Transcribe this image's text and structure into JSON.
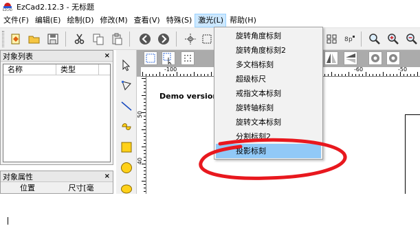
{
  "window": {
    "title": "EzCad2.12.3 - 无标题",
    "logo_text": "EZCAD"
  },
  "menubar": {
    "items": [
      {
        "label": "文件(F)"
      },
      {
        "label": "编辑(E)"
      },
      {
        "label": "绘制(D)"
      },
      {
        "label": "修改(M)"
      },
      {
        "label": "查看(V)"
      },
      {
        "label": "特殊(S)"
      },
      {
        "label": "激光(L)"
      },
      {
        "label": "帮助(H)"
      }
    ]
  },
  "laser_menu": {
    "items": [
      {
        "label": "旋转角度标刻"
      },
      {
        "label": "旋转角度标刻2"
      },
      {
        "label": "多文档标刻"
      },
      {
        "label": "超级标尺"
      },
      {
        "label": "戒指文本标刻"
      },
      {
        "label": "旋转轴标刻"
      },
      {
        "label": "旋转文本标刻"
      },
      {
        "label": "分割标刻2"
      },
      {
        "label": "投影标刻"
      }
    ],
    "highlighted": "投影标刻"
  },
  "object_list_panel": {
    "title": "对象列表",
    "close": "×",
    "columns": [
      "名称",
      "类型"
    ]
  },
  "object_props_panel": {
    "title": "对象属性",
    "close": "×",
    "columns": [
      "位置",
      "尺寸[毫"
    ]
  },
  "canvas": {
    "demo_text": "Demo version",
    "h_ruler_labels": [
      "-100",
      "-60",
      "-50"
    ],
    "v_ruler_labels": [
      "50",
      "40"
    ]
  },
  "toolbar": {
    "icons": [
      "open-file-icon",
      "open-folder-icon",
      "save-icon",
      "cut-icon",
      "copy-icon",
      "paste-icon",
      "back-icon",
      "forward-icon",
      "pan-icon",
      "zoom-in-icon",
      "zoom-out-icon"
    ]
  },
  "colors": {
    "annotation_red": "#e8181e",
    "menu_highlight": "#91c9f7",
    "menubar_active": "#cce8ff"
  }
}
